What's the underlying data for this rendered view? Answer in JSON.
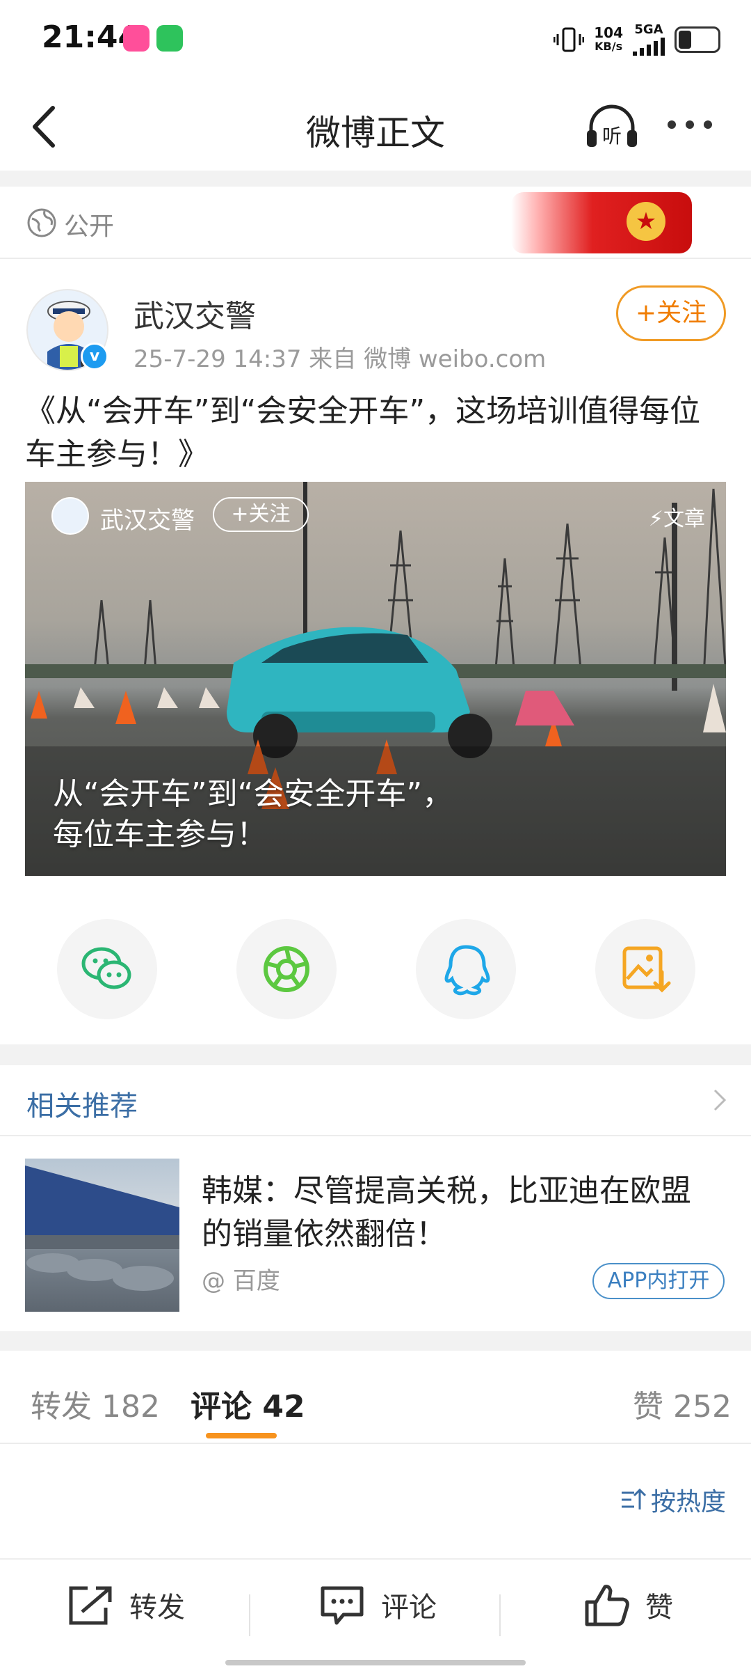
{
  "status_bar": {
    "time": "21:44",
    "net_speed_value": "104",
    "net_speed_unit": "KB/s",
    "signal_label": "5GA"
  },
  "nav": {
    "title": "微博正文",
    "listen_label": "听"
  },
  "visibility": {
    "label": "公开"
  },
  "post": {
    "author": "武汉交警",
    "verified": true,
    "meta": "25-7-29 14:37   来自 微博 weibo.com",
    "follow_label": "+关注",
    "text": "《从“会开车”到“会安全开车”，这场培训值得每位车主参与！》"
  },
  "article_card": {
    "author": "武汉交警",
    "follow_label": "+关注",
    "type_label": "文章",
    "title_line1": "从“会开车”到“会安全开车”，",
    "title_line2": "每位车主参与！"
  },
  "share_targets": [
    "wechat-icon",
    "moments-icon",
    "qq-icon",
    "save-image-icon"
  ],
  "related": {
    "header": "相关推荐",
    "item": {
      "title": "韩媒：尽管提高关税，比亚迪在欧盟的销量依然翻倍！",
      "source": "@ 百度",
      "open_label": "APP内打开"
    }
  },
  "tabs": {
    "repost_label": "转发",
    "repost_count": "182",
    "comment_label": "评论",
    "comment_count": "42",
    "like_label": "赞",
    "like_count": "252",
    "active": "comment"
  },
  "sort_label": "按热度",
  "bottom_bar": {
    "repost": "转发",
    "comment": "评论",
    "like": "赞"
  },
  "colors": {
    "accent_orange": "#f7931e",
    "link_blue": "#3b6ea5",
    "verified_blue": "#1d9bf0"
  }
}
